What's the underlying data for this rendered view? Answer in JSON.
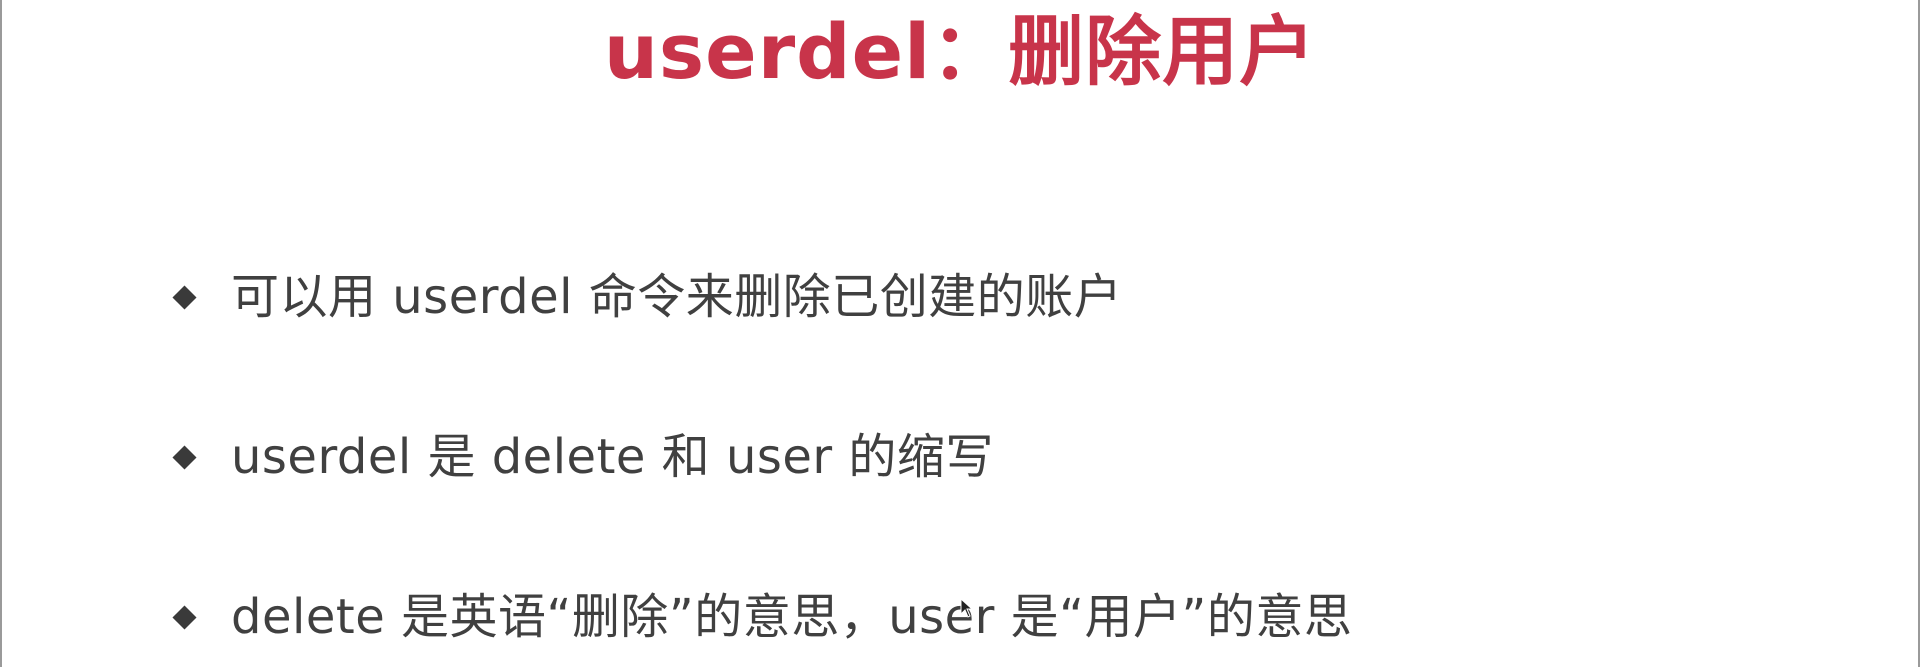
{
  "slide": {
    "title": "userdel：删除用户",
    "bullets": [
      {
        "text": "可以用 userdel 命令来删除已创建的账户"
      },
      {
        "text": "userdel 是 delete 和 user 的缩写"
      },
      {
        "text": "delete 是英语“删除”的意思，user 是“用户”的意思"
      }
    ]
  },
  "colors": {
    "title": "#c8344a",
    "body_text": "#404040",
    "bullet_marker": "#3a3a3a",
    "background": "#ffffff"
  },
  "icons": {
    "bullet": "diamond-bullet-icon",
    "cursor": "mouse-pointer-icon"
  }
}
